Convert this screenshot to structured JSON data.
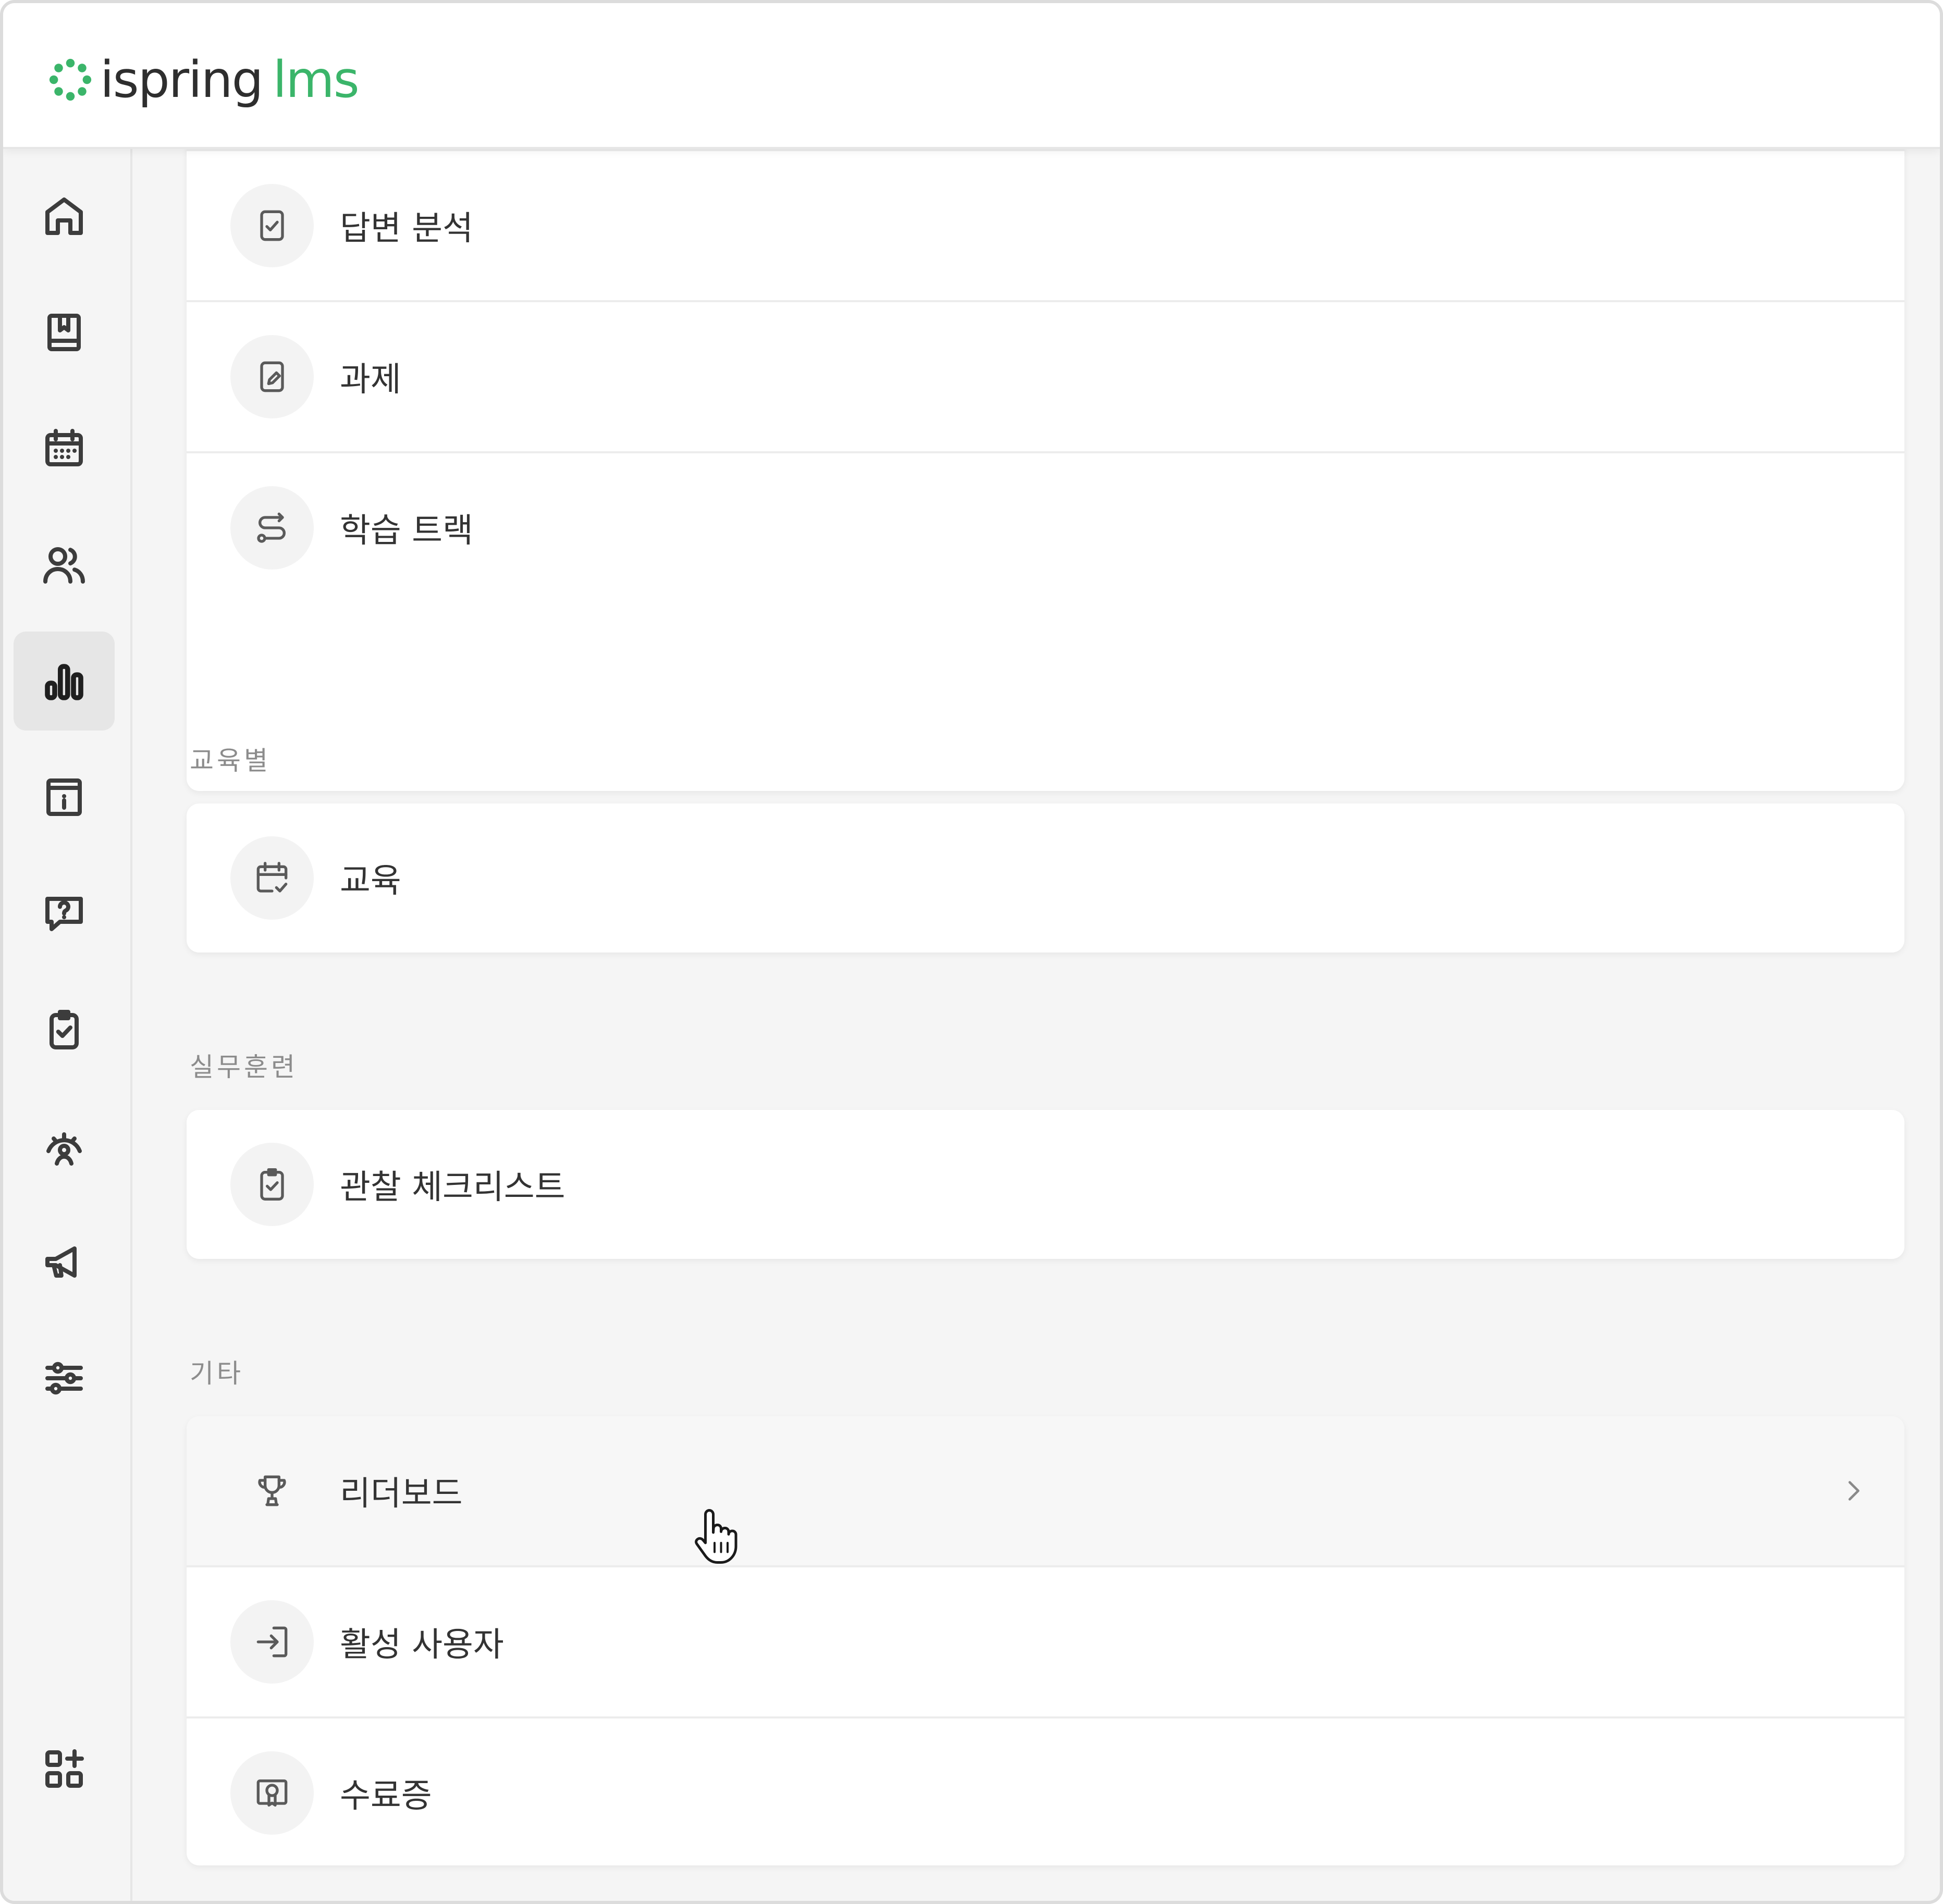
{
  "app": {
    "logo_brand": "ispring",
    "logo_product": "lms",
    "brand_color": "#3bb56a"
  },
  "sidebar": {
    "items": [
      {
        "name": "home",
        "icon": "home-icon"
      },
      {
        "name": "library",
        "icon": "book-bookmark-icon"
      },
      {
        "name": "calendar",
        "icon": "calendar-icon"
      },
      {
        "name": "users",
        "icon": "users-icon"
      },
      {
        "name": "reports",
        "icon": "bar-chart-icon",
        "active": true
      },
      {
        "name": "info",
        "icon": "info-board-icon"
      },
      {
        "name": "questions",
        "icon": "question-chat-icon"
      },
      {
        "name": "checklist",
        "icon": "clipboard-check-icon"
      },
      {
        "name": "assessment",
        "icon": "gauge-person-icon"
      },
      {
        "name": "news",
        "icon": "megaphone-icon"
      },
      {
        "name": "settings",
        "icon": "sliders-icon"
      },
      {
        "name": "add-apps",
        "icon": "apps-plus-icon"
      }
    ]
  },
  "main": {
    "group_top": {
      "items": [
        {
          "label": "답변 분석",
          "icon": "check-document-icon"
        },
        {
          "label": "과제",
          "icon": "edit-document-icon"
        },
        {
          "label": "학습 트랙",
          "icon": "route-icon"
        }
      ]
    },
    "group_events": {
      "title": "교육별",
      "items": [
        {
          "label": "교육",
          "icon": "calendar-check-icon"
        }
      ]
    },
    "group_practice": {
      "title": "실무훈련",
      "items": [
        {
          "label": "관찰 체크리스트",
          "icon": "clipboard-check-icon"
        }
      ]
    },
    "group_other": {
      "title": "기타",
      "items": [
        {
          "label": "리더보드",
          "icon": "trophy-icon",
          "hovered": true
        },
        {
          "label": "활성 사용자",
          "icon": "sign-in-icon"
        },
        {
          "label": "수료증",
          "icon": "certificate-icon"
        }
      ]
    }
  }
}
